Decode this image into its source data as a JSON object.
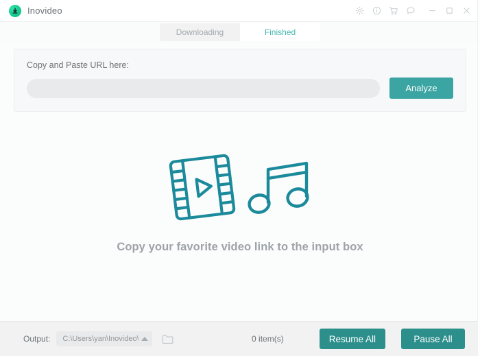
{
  "window": {
    "app_title": "Inovideo",
    "logo_icon": "download-circle-icon",
    "controls": [
      {
        "name": "settings-button",
        "icon": "gear-icon"
      },
      {
        "name": "info-button",
        "icon": "info-circle-icon"
      },
      {
        "name": "store-button",
        "icon": "shopping-cart-icon"
      },
      {
        "name": "feedback-button",
        "icon": "chat-bubble-icon"
      },
      {
        "name": "minimize-button",
        "icon": "minimize-icon"
      },
      {
        "name": "maximize-button",
        "icon": "maximize-icon"
      },
      {
        "name": "close-button",
        "icon": "close-icon"
      }
    ]
  },
  "tabs": [
    {
      "label": "Downloading",
      "active": false
    },
    {
      "label": "Finished",
      "active": true
    }
  ],
  "url_panel": {
    "label": "Copy and Paste URL here:",
    "input_value": "",
    "input_placeholder": "",
    "analyze_label": "Analyze"
  },
  "empty_state": {
    "message": "Copy your favorite video link to the input box",
    "icons": [
      "film-strip-play-icon",
      "music-note-icon"
    ]
  },
  "bottom_bar": {
    "output_label": "Output:",
    "output_path": "C:\\Users\\yan\\Inovideo\\D...",
    "output_caret_icon": "caret-up-icon",
    "folder_icon": "folder-icon",
    "item_count": "0 item(s)",
    "resume_all_label": "Resume All",
    "pause_all_label": "Pause All"
  },
  "colors": {
    "accent_teal": "#3aa5a2",
    "accent_teal_dark": "#2d8f8c",
    "logo_green": "#16c98f",
    "tab_active_text": "#45b7b0",
    "illustration": "#1b8a9b",
    "body_bg": "#fbfcfc",
    "bottom_bar_bg": "#f2f2f2"
  }
}
